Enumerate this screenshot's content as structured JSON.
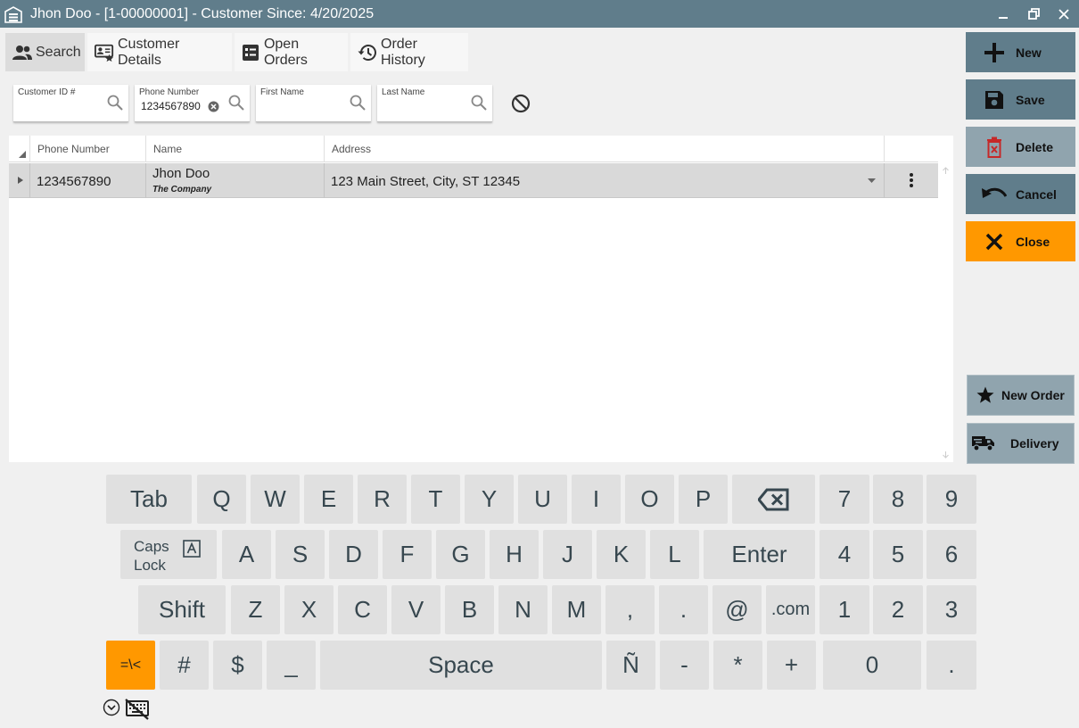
{
  "window": {
    "title": "Jhon Doo - [1-00000001] - Customer Since: 4/20/2025",
    "app_icon": "warehouse-icon",
    "controls": [
      "minimize",
      "restore",
      "close"
    ]
  },
  "tabs": [
    {
      "label": "Search",
      "icon": "people-icon",
      "active": true
    },
    {
      "label": "Customer Details",
      "icon": "contact-card-icon",
      "active": false
    },
    {
      "label": "Open Orders",
      "icon": "list-icon",
      "active": false
    },
    {
      "label": "Order History",
      "icon": "history-icon",
      "active": false
    }
  ],
  "search": {
    "customer_id": {
      "label": "Customer ID #",
      "value": ""
    },
    "phone": {
      "label": "Phone Number",
      "value": "1234567890"
    },
    "first_name": {
      "label": "First Name",
      "value": ""
    },
    "last_name": {
      "label": "Last Name",
      "value": ""
    }
  },
  "grid": {
    "columns": [
      "Phone Number",
      "Name",
      "Address"
    ],
    "rows": [
      {
        "phone": "1234567890",
        "name": "Jhon Doo",
        "company": "The Company",
        "address": "123 Main Street, City, ST 12345"
      }
    ]
  },
  "actions": {
    "new": "New",
    "save": "Save",
    "delete": "Delete",
    "cancel": "Cancel",
    "close": "Close",
    "new_order": "New Order",
    "delivery": "Delivery"
  },
  "colors": {
    "titlebar": "#607d8b",
    "button_dark": "#607d8b",
    "button_light": "#90a4ae",
    "accent_orange": "#ff9800"
  },
  "keyboard": {
    "row1": [
      "Tab",
      "Q",
      "W",
      "E",
      "R",
      "T",
      "Y",
      "U",
      "I",
      "O",
      "P",
      "backspace",
      "7",
      "8",
      "9"
    ],
    "row2_caps": [
      "Caps",
      "Lock"
    ],
    "row2": [
      "A",
      "S",
      "D",
      "F",
      "G",
      "H",
      "J",
      "K",
      "L",
      "Enter",
      "4",
      "5",
      "6"
    ],
    "row3": [
      "Shift",
      "Z",
      "X",
      "C",
      "V",
      "B",
      "N",
      "M",
      ",",
      ".",
      "@",
      ".com",
      "1",
      "2",
      "3"
    ],
    "row4": [
      "=\\<",
      "#",
      "$",
      "_",
      "Space",
      "Ñ",
      "-",
      "*",
      "+",
      "0",
      "."
    ]
  }
}
